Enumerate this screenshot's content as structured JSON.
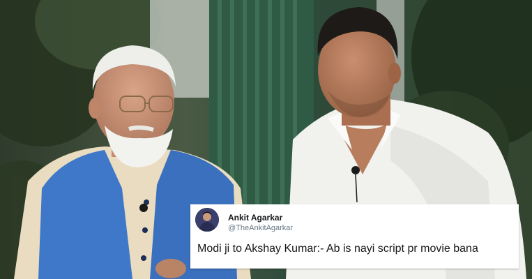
{
  "tweet": {
    "author_name": "Ankit Agarkar",
    "author_handle": "@TheAnkitAgarkar",
    "text": "Modi ji to Akshay Kumar:- Ab is nayi script pr movie bana",
    "avatar_icon": "user-avatar-icon"
  },
  "colors": {
    "card_background": "#ffffff",
    "name_color": "#14171a",
    "handle_color": "#657786",
    "vest_blue": "#3f78c9",
    "shirt_white": "#f1f1ee"
  }
}
